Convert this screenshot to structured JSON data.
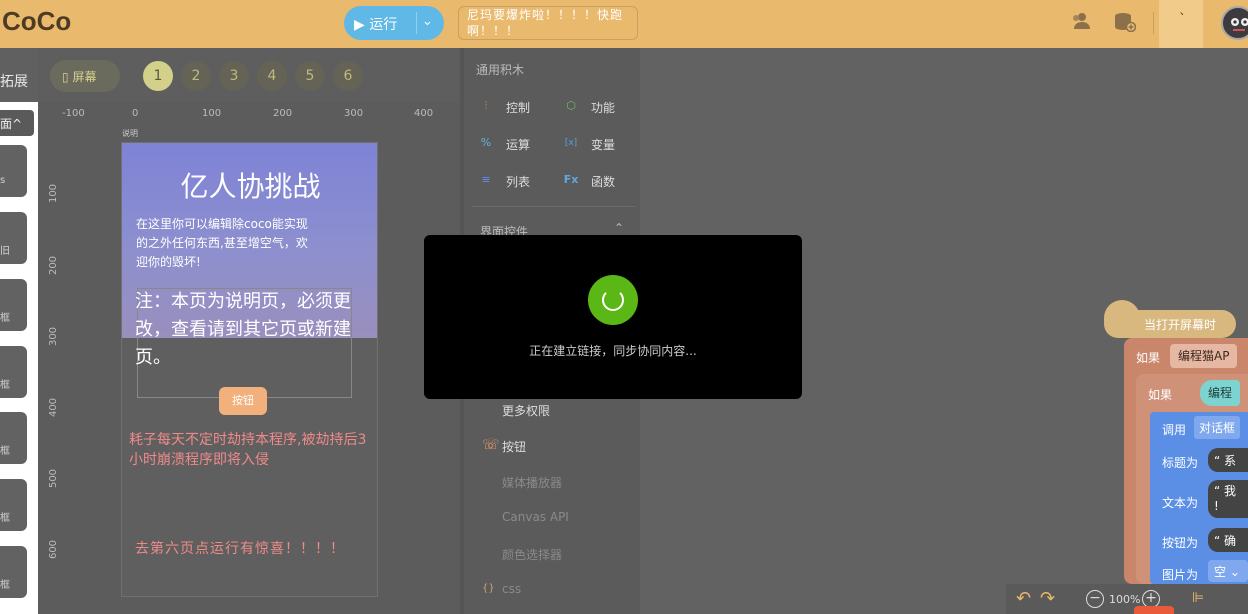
{
  "app": {
    "logo": "CoCo"
  },
  "toolbar": {
    "run_label": "▶ 运行",
    "run_menu": "⌄",
    "notice": "尼玛要爆炸啦！！！！快跑啊！！！",
    "highlight_btn": "`"
  },
  "left": {
    "extend": "拓展",
    "page_select": "面^",
    "thumbs": [
      "s",
      "旧",
      "框",
      "框",
      "框",
      "框",
      "框"
    ]
  },
  "pages": {
    "screen_label": "屏幕",
    "numbers": [
      "1",
      "2",
      "3",
      "4",
      "5",
      "6"
    ],
    "active": "1"
  },
  "ruler": {
    "h": [
      "-100",
      "0",
      "100",
      "200",
      "300",
      "400"
    ],
    "v": [
      "100",
      "200",
      "300",
      "400",
      "500",
      "600"
    ]
  },
  "phone": {
    "caption": "说明",
    "title": "亿人协挑战",
    "desc": "在这里你可以编辑除coco能实现的之外任何东西,甚至增空气，欢迎你的毁坏!",
    "note": "注：本页为说明页，必须更改，查看请到其它页或新建页。",
    "button": "按钮",
    "warning": "耗子每天不定时劫持本程序,被劫持后3小时崩溃程序即将入侵",
    "go": "去第六页点运行有惊喜！！！！"
  },
  "blocks": {
    "general_header": "通用积木",
    "general": [
      {
        "icon": "control-icon",
        "glyph": "⫶",
        "label": "控制",
        "color": "#e8875b"
      },
      {
        "icon": "function-icon",
        "glyph": "⬡",
        "label": "功能",
        "color": "#6bbf63"
      },
      {
        "icon": "math-icon",
        "glyph": "%",
        "label": "运算",
        "color": "#60b4df"
      },
      {
        "icon": "variable-icon",
        "glyph": "[x]",
        "label": "变量",
        "color": "#5a9ee6"
      },
      {
        "icon": "list-icon",
        "glyph": "≡",
        "label": "列表",
        "color": "#6b8fe6"
      },
      {
        "icon": "function-fx-icon",
        "glyph": "Fx",
        "label": "函数",
        "color": "#5fa8dc"
      }
    ],
    "ui_header": "界面控件",
    "more_perms": "更多权限",
    "items": [
      "按钮",
      "媒体播放器",
      "Canvas API",
      "颜色选择器",
      "css"
    ]
  },
  "workspace": {
    "event": "当打开屏幕时",
    "if1": "如果",
    "if1_val": "编程猫AP",
    "if2": "如果",
    "if2_val": "编程",
    "call": "调用",
    "call_val": "对话框",
    "rows": [
      {
        "label": "标题为",
        "val": "“ 系"
      },
      {
        "label": "文本为",
        "val": "“ 我\n!"
      },
      {
        "label": "按钮为",
        "val": "“ 确"
      },
      {
        "label": "图片为",
        "val": "空 ⌄"
      }
    ]
  },
  "bottom": {
    "zoom": "100%"
  },
  "modal": {
    "text": "正在建立链接，同步协同内容..."
  }
}
